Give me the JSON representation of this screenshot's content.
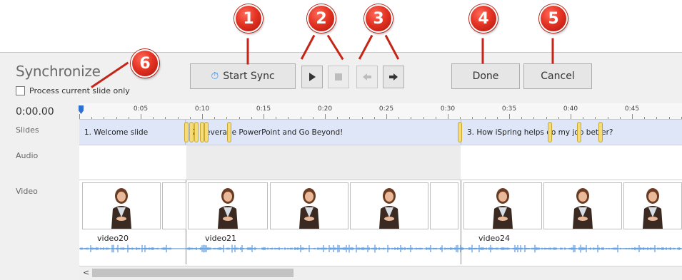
{
  "panel": {
    "title": "Synchronize",
    "checkbox_label": "Process current slide only",
    "checkbox_checked": false
  },
  "toolbar": {
    "start_sync_label": "Start Sync",
    "done_label": "Done",
    "cancel_label": "Cancel",
    "play_icon": "play-icon",
    "stop_icon": "stop-icon",
    "prev_icon": "arrow-left-icon",
    "next_icon": "arrow-right-icon",
    "timer_icon": "stopwatch-icon"
  },
  "callouts": [
    "1",
    "2",
    "3",
    "4",
    "5",
    "6"
  ],
  "timeline": {
    "current_time": "0:00.00",
    "ticks": [
      "0:05",
      "0:10",
      "0:15",
      "0:20",
      "0:25",
      "0:30",
      "0:35",
      "0:40",
      "0:45"
    ],
    "rows": {
      "slides": "Slides",
      "audio": "Audio",
      "video": "Video"
    },
    "slides": [
      "1. Welcome slide",
      "2. Leverage PowerPoint and Go Beyond!",
      "3. How iSpring helps do my job better?"
    ],
    "videos": [
      "video20",
      "video21",
      "video24"
    ]
  },
  "colors": {
    "callout": "#e43424",
    "slide_track": "#dfe6f7",
    "marker": "#f5dc78",
    "wave": "#3a86d8"
  }
}
